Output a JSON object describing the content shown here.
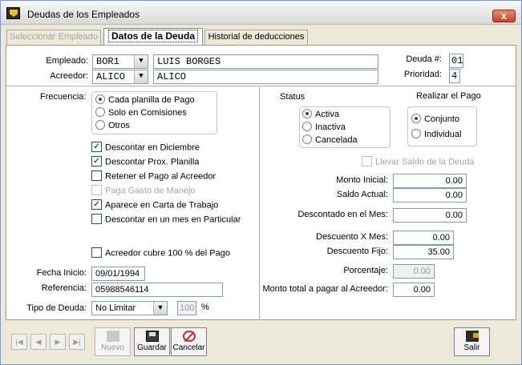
{
  "window": {
    "title": "Deudas de los Empleados",
    "close_symbol": "x"
  },
  "tabs": [
    {
      "label": "Seleccionar Empleado",
      "state": "disabled"
    },
    {
      "label": "Datos de la Deuda",
      "state": "active"
    },
    {
      "label": "Historial de deducciones",
      "state": "normal"
    }
  ],
  "header": {
    "empleado_label": "Empleado:",
    "empleado_code": "BOR1",
    "empleado_name": "LUIS BORGES",
    "acreedor_label": "Acreedor:",
    "acreedor_code": "ALICO",
    "acreedor_name": "ALICO",
    "deuda_label": "Deuda #:",
    "deuda_value": "01",
    "prioridad_label": "Prioridad:",
    "prioridad_value": "4"
  },
  "frecuencia": {
    "label": "Frecuencia:",
    "options": [
      {
        "label": "Cada planilla de Pago",
        "selected": true
      },
      {
        "label": "Solo en Comisiones",
        "selected": false
      },
      {
        "label": "Otros",
        "selected": false
      }
    ]
  },
  "checkboxes": [
    {
      "label": "Descontar en Diciembre",
      "checked": true,
      "enabled": true
    },
    {
      "label": "Descontar Prox. Planilla",
      "checked": true,
      "enabled": true
    },
    {
      "label": "Retener el Pago al Acreedor",
      "checked": false,
      "enabled": true
    },
    {
      "label": "Paga Gasto de Manejo",
      "checked": false,
      "enabled": false
    },
    {
      "label": "Aparece en Carta de Trabajo",
      "checked": true,
      "enabled": true
    },
    {
      "label": "Descontar en un mes en Particular",
      "checked": false,
      "enabled": true
    }
  ],
  "acreedor_cubre": {
    "label": "Acreedor cubre 100 % del Pago",
    "checked": false
  },
  "fecha_inicio": {
    "label": "Fecha Inicio:",
    "value": "09/01/1994"
  },
  "referencia": {
    "label": "Referencia:",
    "value": "05988546114"
  },
  "tipo_deuda": {
    "label": "Tipo de Deuda:",
    "value": "No Limitar",
    "pct_value": "100",
    "pct_symbol": "%"
  },
  "status": {
    "label": "Status",
    "options": [
      {
        "label": "Activa",
        "selected": true
      },
      {
        "label": "Inactiva",
        "selected": false
      },
      {
        "label": "Cancelada",
        "selected": false
      }
    ]
  },
  "realizar_pago": {
    "label": "Realizar el Pago",
    "options": [
      {
        "label": "Conjunto",
        "selected": true
      },
      {
        "label": "Individual",
        "selected": false
      }
    ]
  },
  "llevar_saldo": {
    "label": "Llevar Saldo de la Deuda",
    "checked": false,
    "enabled": false
  },
  "amounts": {
    "monto_inicial_label": "Monto Inicial:",
    "monto_inicial": "0.00",
    "saldo_actual_label": "Saldo Actual:",
    "saldo_actual": "0.00",
    "descontado_mes_label": "Descontado en el Mes:",
    "descontado_mes": "0.00",
    "descuento_x_mes_label": "Descuento X Mes:",
    "descuento_x_mes": "0.00",
    "descuento_fijo_label": "Descuento Fijo:",
    "descuento_fijo": "35.00",
    "porcentaje_label": "Porcentaje:",
    "porcentaje": "0.00",
    "monto_total_label": "Monto total a pagar al Acreedor:",
    "monto_total": "0.00"
  },
  "toolbar": {
    "nav_first": "|◀",
    "nav_prev": "◀",
    "nav_next": "▶",
    "nav_last": "▶|",
    "nuevo_label": "Nuevo",
    "guardar_label": "Guardar",
    "cancelar_label": "Cancelar",
    "salir_label": "Salir"
  }
}
